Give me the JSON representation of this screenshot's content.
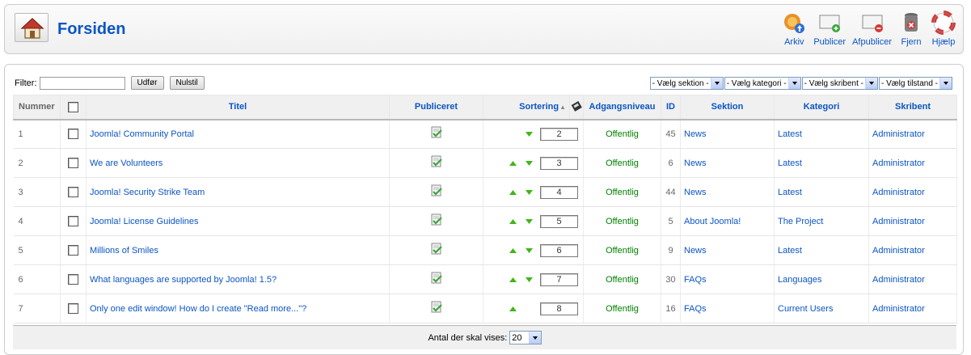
{
  "header": {
    "title": "Forsiden"
  },
  "toolbar": [
    {
      "label": "Arkiv",
      "icon": "archive-icon"
    },
    {
      "label": "Publicer",
      "icon": "publish-icon"
    },
    {
      "label": "Afpublicer",
      "icon": "unpublish-icon"
    },
    {
      "label": "Fjern",
      "icon": "trash-icon"
    },
    {
      "label": "Hjælp",
      "icon": "help-icon"
    }
  ],
  "filter": {
    "label": "Filter:",
    "value": "",
    "go_label": "Udfør",
    "reset_label": "Nulstil"
  },
  "selects": [
    "- Vælg sektion -",
    "- Vælg kategori -",
    "- Vælg skribent -",
    "- Vælg tilstand -"
  ],
  "columns": {
    "num": "Nummer",
    "title": "Titel",
    "published": "Publiceret",
    "ordering": "Sortering",
    "access": "Adgangsniveau",
    "id": "ID",
    "section": "Sektion",
    "category": "Kategori",
    "author": "Skribent"
  },
  "rows": [
    {
      "num": "1",
      "title": "Joomla! Community Portal",
      "up": false,
      "down": true,
      "order": "2",
      "access": "Offentlig",
      "id": "45",
      "section": "News",
      "category": "Latest",
      "author": "Administrator"
    },
    {
      "num": "2",
      "title": "We are Volunteers",
      "up": true,
      "down": true,
      "order": "3",
      "access": "Offentlig",
      "id": "6",
      "section": "News",
      "category": "Latest",
      "author": "Administrator"
    },
    {
      "num": "3",
      "title": "Joomla! Security Strike Team",
      "up": true,
      "down": true,
      "order": "4",
      "access": "Offentlig",
      "id": "44",
      "section": "News",
      "category": "Latest",
      "author": "Administrator"
    },
    {
      "num": "4",
      "title": "Joomla! License Guidelines",
      "up": true,
      "down": true,
      "order": "5",
      "access": "Offentlig",
      "id": "5",
      "section": "About Joomla!",
      "category": "The Project",
      "author": "Administrator"
    },
    {
      "num": "5",
      "title": "Millions of Smiles",
      "up": true,
      "down": true,
      "order": "6",
      "access": "Offentlig",
      "id": "9",
      "section": "News",
      "category": "Latest",
      "author": "Administrator"
    },
    {
      "num": "6",
      "title": "What languages are supported by Joomla! 1.5?",
      "up": true,
      "down": true,
      "order": "7",
      "access": "Offentlig",
      "id": "30",
      "section": "FAQs",
      "category": "Languages",
      "author": "Administrator"
    },
    {
      "num": "7",
      "title": "Only one edit window! How do I create \"Read more...\"?",
      "up": true,
      "down": false,
      "order": "8",
      "access": "Offentlig",
      "id": "16",
      "section": "FAQs",
      "category": "Current Users",
      "author": "Administrator"
    }
  ],
  "footer": {
    "label": "Antal der skal vises:",
    "limit": "20"
  }
}
